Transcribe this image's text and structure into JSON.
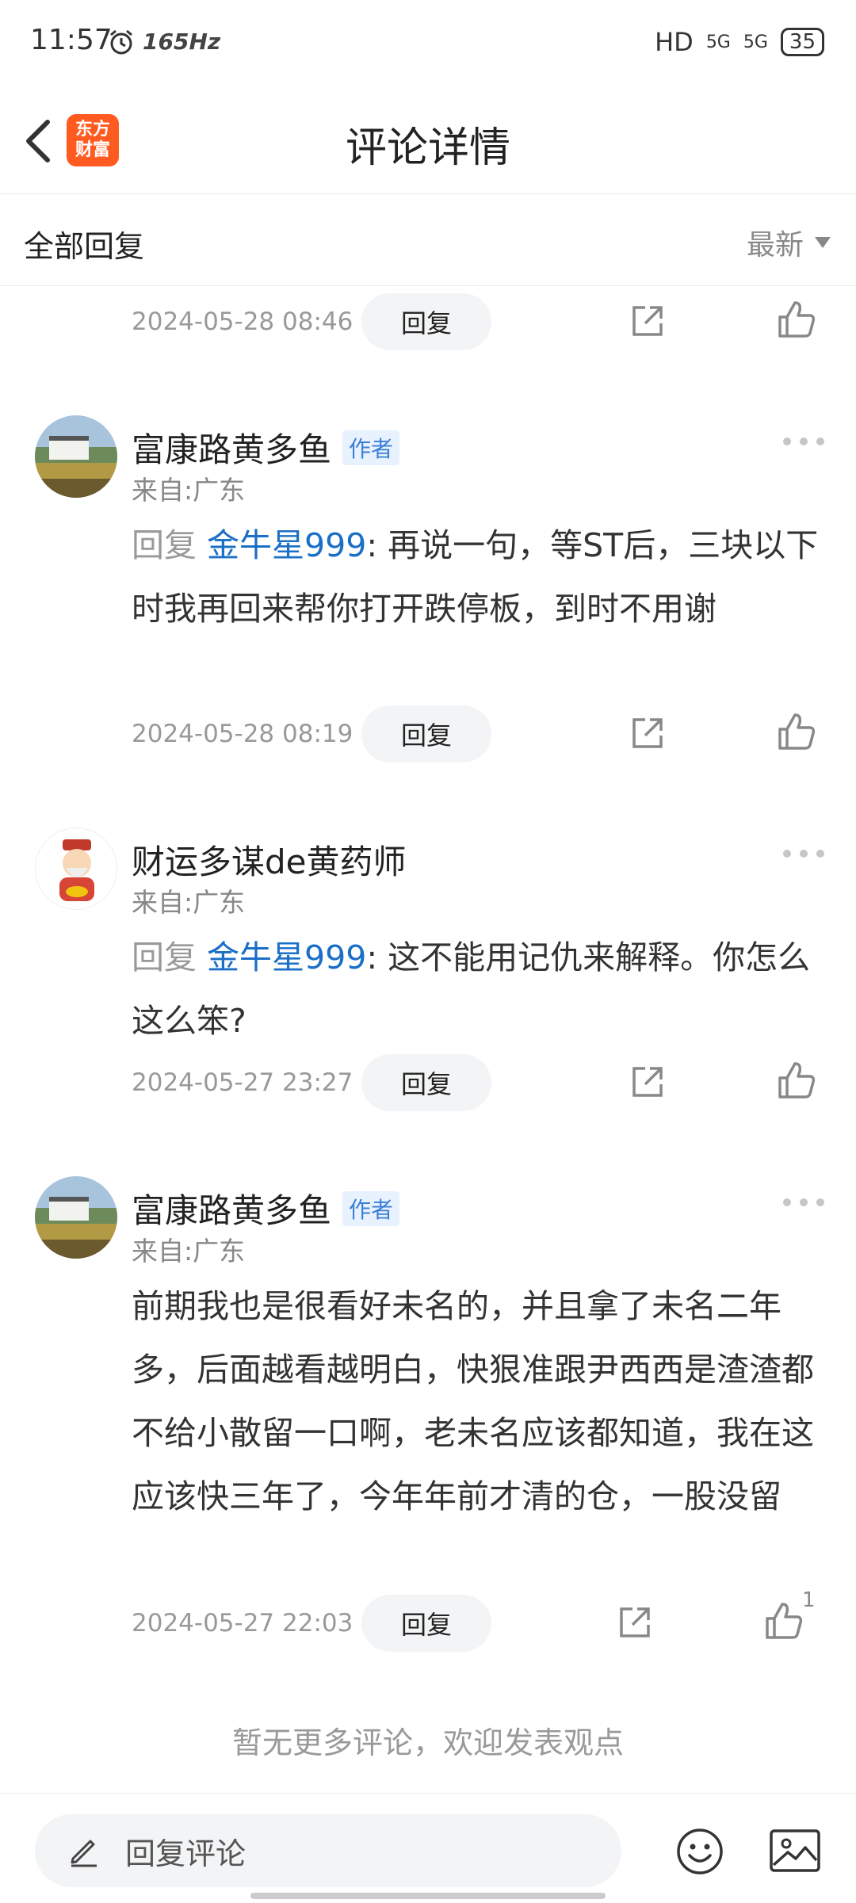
{
  "status_bar": {
    "time": "11:57",
    "refresh_rate": "165Hz",
    "network": "HD",
    "signal1": "5G",
    "signal2": "5G",
    "battery": "35"
  },
  "header": {
    "title": "评论详情",
    "logo_line1": "东方",
    "logo_line2": "财富"
  },
  "filter": {
    "left_label": "全部回复",
    "sort_label": "最新"
  },
  "top_partial": {
    "date": "2024-05-28 08:46",
    "reply_label": "回复"
  },
  "comments": [
    {
      "name": "富康路黄多鱼",
      "badge": "作者",
      "from": "来自:广东",
      "reply_prefix": "回复",
      "mention": "金牛星999",
      "text": ": 再说一句，等ST后，三块以下时我再回来帮你打开跌停板，到时不用谢",
      "date": "2024-05-28 08:19",
      "reply_label": "回复"
    },
    {
      "name": "财运多谋de黄药师",
      "from": "来自:广东",
      "reply_prefix": "回复",
      "mention": "金牛星999",
      "text": ": 这不能用记仇来解释。你怎么这么笨?",
      "date": "2024-05-27 23:27",
      "reply_label": "回复"
    },
    {
      "name": "富康路黄多鱼",
      "badge": "作者",
      "from": "来自:广东",
      "text": "前期我也是很看好未名的，并且拿了未名二年多，后面越看越明白，快狠准跟尹西西是渣渣都不给小散留一口啊，老未名应该都知道，我在这应该快三年了，今年年前才清的仓，一股没留",
      "date": "2024-05-27 22:03",
      "reply_label": "回复",
      "like_count": "1"
    }
  ],
  "footer_note": "暂无更多评论，欢迎发表观点",
  "bottom": {
    "input_placeholder": "回复评论"
  },
  "colors": {
    "accent": "#1a6fc7",
    "logo": "#ff5a1f",
    "badge_bg": "#e8f2ff"
  },
  "icons": [
    "back-icon",
    "alarm-icon",
    "share-icon",
    "like-icon",
    "more-icon",
    "pen-icon",
    "emoji-icon",
    "image-icon",
    "sort-down-icon"
  ]
}
